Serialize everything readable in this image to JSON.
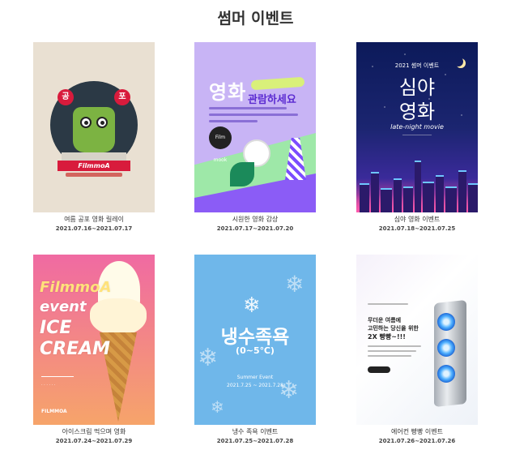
{
  "page": {
    "title": "썸머 이벤트"
  },
  "events": [
    {
      "title": "여름 공포 영화 릴레이",
      "dates": "2021.07.16~2021.07.17",
      "poster": {
        "tag_left": "공",
        "tag_right": "포",
        "brand": "FilmmoA"
      }
    },
    {
      "title": "시원한 영화 감상",
      "dates": "2021.07.17~2021.07.20",
      "poster": {
        "headline": "영화",
        "tagline": "관람하세요",
        "badge": "Film mook"
      }
    },
    {
      "title": "심야 영화 이벤트",
      "dates": "2021.07.18~2021.07.25",
      "poster": {
        "year_line": "2021 썸머 이벤트",
        "line1": "심야",
        "line2": "영화",
        "english": "late-night movie"
      }
    },
    {
      "title": "아이스크림 먹으며 영화",
      "dates": "2021.07.24~2021.07.29",
      "poster": {
        "w1": "FilmmoA",
        "w2": "event",
        "w3": "ICE",
        "w4": "CREAM",
        "brand": "FILMMOA"
      }
    },
    {
      "title": "냉수 족욕 이벤트",
      "dates": "2021.07.25~2021.07.28",
      "poster": {
        "headline": "냉수족욕",
        "range": "(0~5℃)",
        "sub1": "Summer Event",
        "sub2": "2021.7.25 ~ 2021.7.28"
      }
    },
    {
      "title": "에어컨 빵빵 이벤트",
      "dates": "2021.07.26~2021.07.26",
      "poster": {
        "line1": "무더운 여름에",
        "line2": "고민하는 당신을 위한",
        "line3": "2X 빵빵~!!!"
      }
    }
  ],
  "colors": {
    "text": "#333333",
    "date_text": "#444444"
  }
}
